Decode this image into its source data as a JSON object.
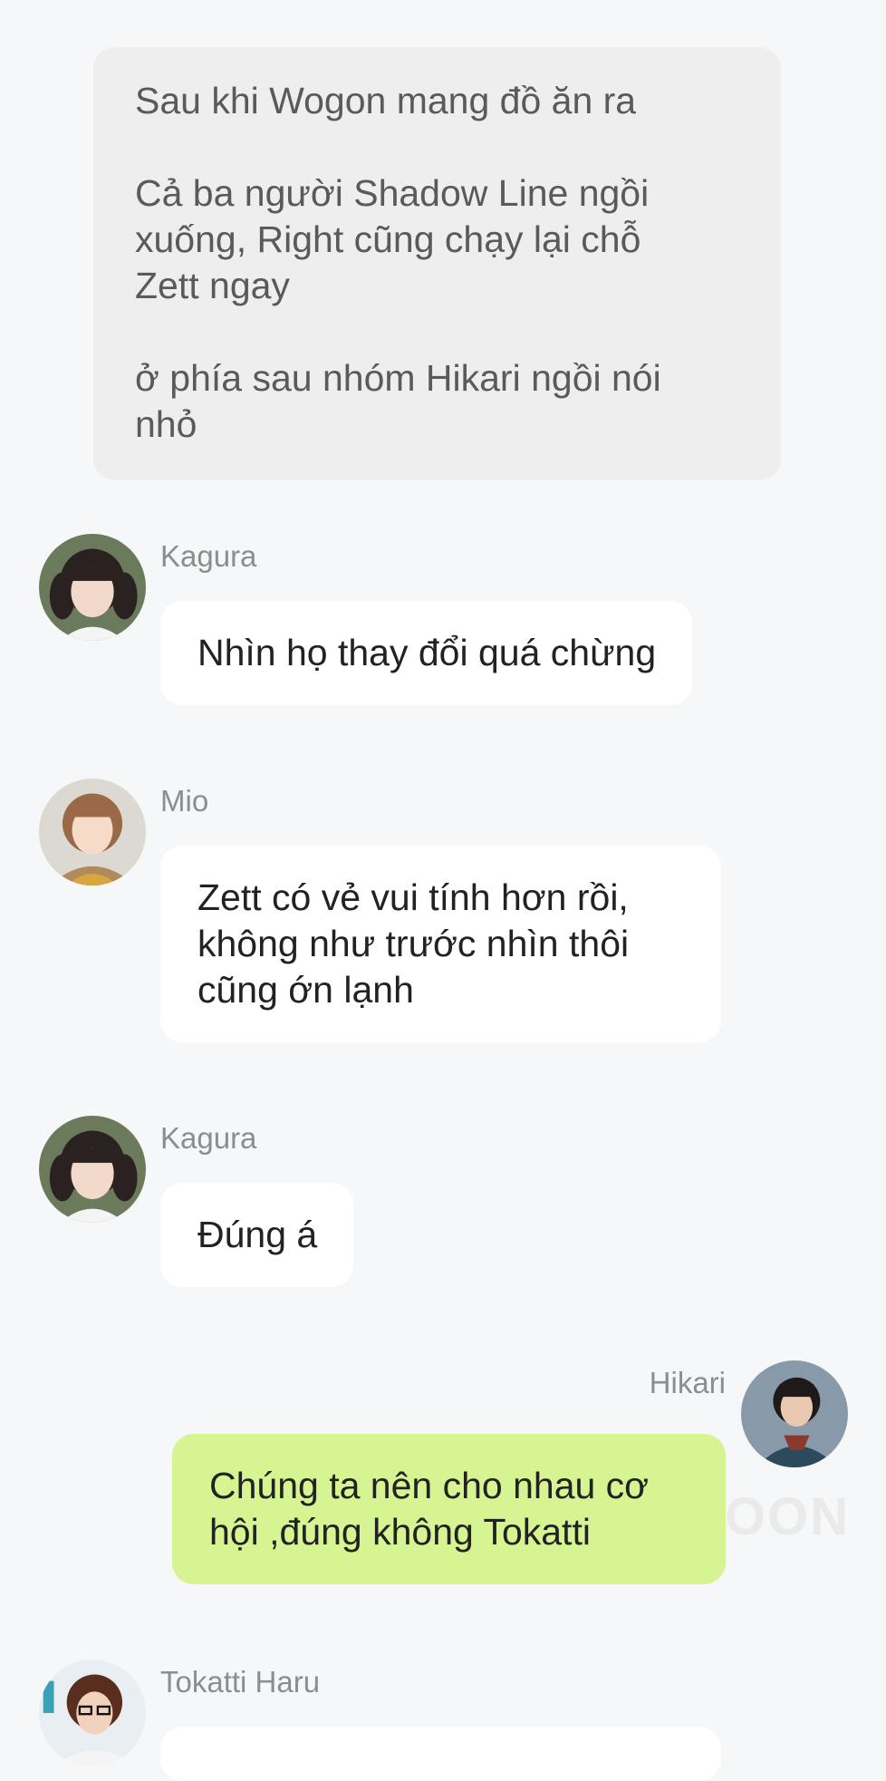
{
  "narration": {
    "paragraphs": [
      "Sau khi Wogon mang đồ ăn ra",
      "Cả ba người Shadow Line ngồi xuống, Right cũng chạy lại chỗ Zett ngay",
      "ở phía sau nhóm Hikari ngồi nói nhỏ"
    ]
  },
  "messages": [
    {
      "sender": "Kagura",
      "text": "Nhìn họ thay đổi quá chừng",
      "avatar_icon": "kagura-avatar"
    },
    {
      "sender": "Mio",
      "text": "Zett có vẻ vui tính hơn rồi, không như trước nhìn thôi cũng ớn lạnh",
      "avatar_icon": "mio-avatar"
    },
    {
      "sender": "Kagura",
      "text": "Đúng á",
      "avatar_icon": "kagura-avatar"
    },
    {
      "sender": "Hikari",
      "text": "Chúng ta nên cho nhau cơ hội ,đúng không Tokatti",
      "avatar_icon": "hikari-avatar",
      "own": true
    },
    {
      "sender": "Tokatti Haru",
      "text": "",
      "avatar_icon": "tokatti-avatar"
    }
  ],
  "watermark": "OON",
  "colors": {
    "background": "#f6f7f9",
    "narration_bg": "#eeeeee",
    "bubble_incoming": "#ffffff",
    "bubble_outgoing": "#d6f592",
    "name_text": "#8d8d8d"
  }
}
